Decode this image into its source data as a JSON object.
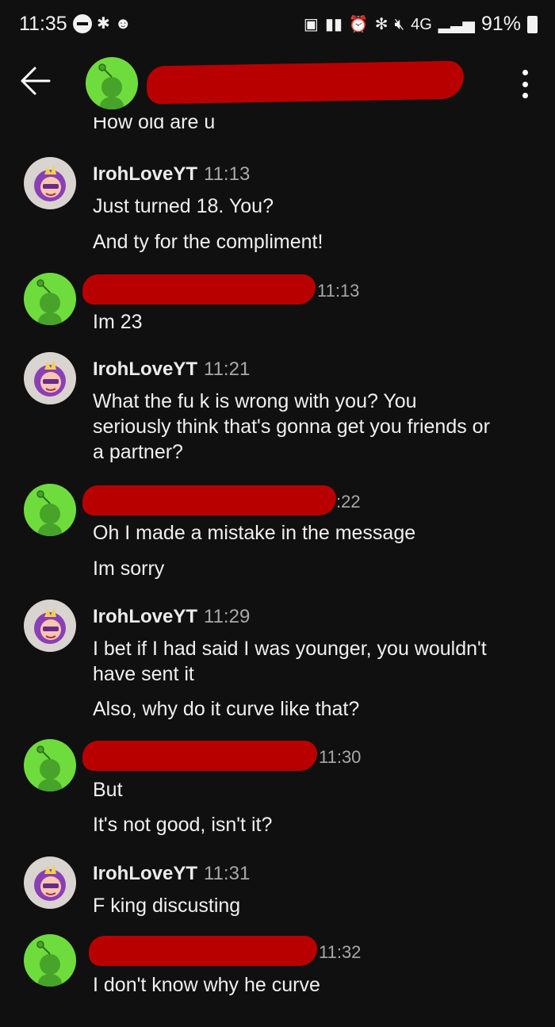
{
  "status_bar": {
    "time": "11:35",
    "network": "4G",
    "battery": "91%"
  },
  "header": {
    "back_icon": "arrow-left-icon",
    "menu_icon": "more-vertical-icon"
  },
  "colors": {
    "background": "#101010",
    "redaction": "#b80000",
    "snoo_green": "#6fdc3d",
    "timestamp": "#a8a8a8"
  },
  "chat": {
    "cut_message": "How old are u",
    "messages": [
      {
        "sender": "IrohLoveYT",
        "time": "11:13",
        "lines": [
          "Just turned 18. You?",
          "And ty for the compliment!"
        ]
      },
      {
        "sender": "",
        "time": "11:13",
        "lines": [
          "Im 23"
        ]
      },
      {
        "sender": "IrohLoveYT",
        "time": "11:21",
        "lines": [
          "What the fu k is wrong with you? You",
          "seriously think that's gonna get you friends or",
          "a partner?"
        ]
      },
      {
        "sender": "",
        "time": ":22",
        "lines": [
          "Oh I made a mistake in the message",
          "Im sorry"
        ]
      },
      {
        "sender": "IrohLoveYT",
        "time": "11:29",
        "lines": [
          "I bet if I had said I was younger, you wouldn't",
          "have sent it",
          "Also, why do it curve like that?"
        ]
      },
      {
        "sender": "",
        "time": "11:30",
        "lines": [
          "But",
          "It's not good, isn't it?"
        ]
      },
      {
        "sender": "IrohLoveYT",
        "time": "11:31",
        "lines": [
          "F king discusting"
        ]
      },
      {
        "sender": "",
        "time": "11:32",
        "lines": [
          "I don't know why he curve"
        ]
      }
    ]
  }
}
